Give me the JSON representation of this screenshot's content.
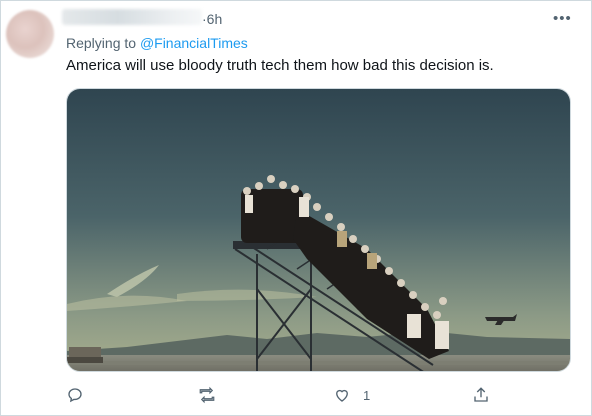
{
  "tweet": {
    "time": "6h",
    "more_label": "•••",
    "replying_prefix": "Replying to ",
    "replying_handle": "@FinancialTimes",
    "text": "America will use bloody truth tech them how bad this decision is."
  },
  "actions": {
    "reply_count": "",
    "retweet_count": "",
    "like_count": "1",
    "share_count": ""
  },
  "icons": {
    "reply": "reply-icon",
    "retweet": "retweet-icon",
    "like": "heart-icon",
    "share": "share-icon"
  },
  "colors": {
    "link": "#1d9bf0",
    "muted": "#536471",
    "text": "#0f1419"
  }
}
